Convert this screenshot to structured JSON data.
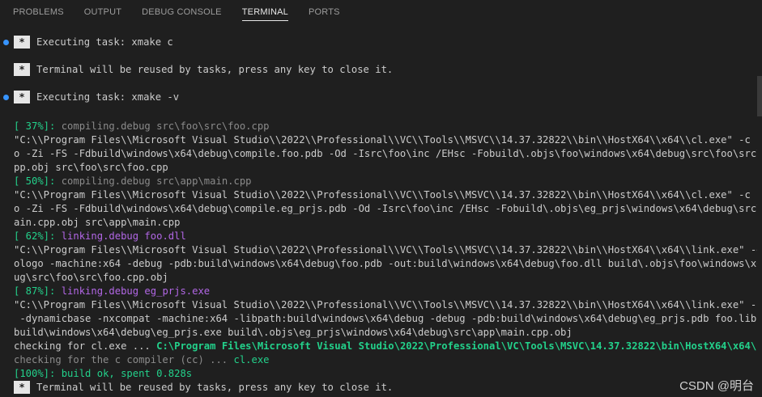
{
  "tabs": [
    "PROBLEMS",
    "OUTPUT",
    "DEBUG CONSOLE",
    "TERMINAL",
    "PORTS"
  ],
  "active_tab": "TERMINAL",
  "task1": {
    "star": "*",
    "text": "Executing task: xmake c"
  },
  "reuse1": {
    "star": "*",
    "text": "Terminal will be reused by tasks, press any key to close it."
  },
  "task2": {
    "star": "*",
    "text": "Executing task: xmake -v"
  },
  "lines": {
    "p37": "[ 37%]:",
    "p37_msg": " compiling.debug src\\foo\\src\\foo.cpp",
    "cmd1_1": "\"C:\\\\Program Files\\\\Microsoft Visual Studio\\\\2022\\\\Professional\\\\VC\\\\Tools\\\\MSVC\\\\14.37.32822\\\\bin\\\\HostX64\\\\x64\\\\cl.exe\" -c -nolog",
    "cmd1_2": "o -Zi -FS -Fdbuild\\windows\\x64\\debug\\compile.foo.pdb -Od -Isrc\\foo\\inc /EHsc -Fobuild\\.objs\\foo\\windows\\x64\\debug\\src\\foo\\src\\foo.c",
    "cmd1_3": "pp.obj src\\foo\\src\\foo.cpp",
    "p50": "[ 50%]:",
    "p50_msg": " compiling.debug src\\app\\main.cpp",
    "cmd2_1": "\"C:\\\\Program Files\\\\Microsoft Visual Studio\\\\2022\\\\Professional\\\\VC\\\\Tools\\\\MSVC\\\\14.37.32822\\\\bin\\\\HostX64\\\\x64\\\\cl.exe\" -c -nolog",
    "cmd2_2": "o -Zi -FS -Fdbuild\\windows\\x64\\debug\\compile.eg_prjs.pdb -Od -Isrc\\foo\\inc /EHsc -Fobuild\\.objs\\eg_prjs\\windows\\x64\\debug\\src\\app\\m",
    "cmd2_3": "ain.cpp.obj src\\app\\main.cpp",
    "p62": "[ 62%]:",
    "p62_msg": " linking.debug foo.dll",
    "cmd3_1": "\"C:\\\\Program Files\\\\Microsoft Visual Studio\\\\2022\\\\Professional\\\\VC\\\\Tools\\\\MSVC\\\\14.37.32822\\\\bin\\\\HostX64\\\\x64\\\\link.exe\" -dll -n",
    "cmd3_2": "ologo -machine:x64 -debug -pdb:build\\windows\\x64\\debug\\foo.pdb -out:build\\windows\\x64\\debug\\foo.dll build\\.objs\\foo\\windows\\x64\\deb",
    "cmd3_3": "ug\\src\\foo\\src\\foo.cpp.obj",
    "p87": "[ 87%]:",
    "p87_msg": " linking.debug eg_prjs.exe",
    "cmd4_1": "\"C:\\\\Program Files\\\\Microsoft Visual Studio\\\\2022\\\\Professional\\\\VC\\\\Tools\\\\MSVC\\\\14.37.32822\\\\bin\\\\HostX64\\\\x64\\\\link.exe\" -nologo",
    "cmd4_2": " -dynamicbase -nxcompat -machine:x64 -libpath:build\\windows\\x64\\debug -debug -pdb:build\\windows\\x64\\debug\\eg_prjs.pdb foo.lib -out:",
    "cmd4_3": "build\\windows\\x64\\debug\\eg_prjs.exe build\\.objs\\eg_prjs\\windows\\x64\\debug\\src\\app\\main.cpp.obj",
    "check_cl_prefix": "checking for cl.exe ... ",
    "check_cl_path": "C:\\Program Files\\Microsoft Visual Studio\\2022\\Professional\\VC\\Tools\\MSVC\\14.37.32822\\bin\\HostX64\\x64\\cl.exe",
    "check_cc_prefix": "checking for the c compiler (cc) ... ",
    "check_cc_result": "cl.exe",
    "p100": "[100%]:",
    "p100_msg": " build ok, spent 0.828s"
  },
  "reuse2": {
    "star": "*",
    "text": "Terminal will be reused by tasks, press any key to close it."
  },
  "watermark": "CSDN @明台",
  "colors": {
    "background": "#1f1f1f",
    "green": "#23d18b",
    "magenta": "#b267e6",
    "dot": "#3794ff"
  }
}
